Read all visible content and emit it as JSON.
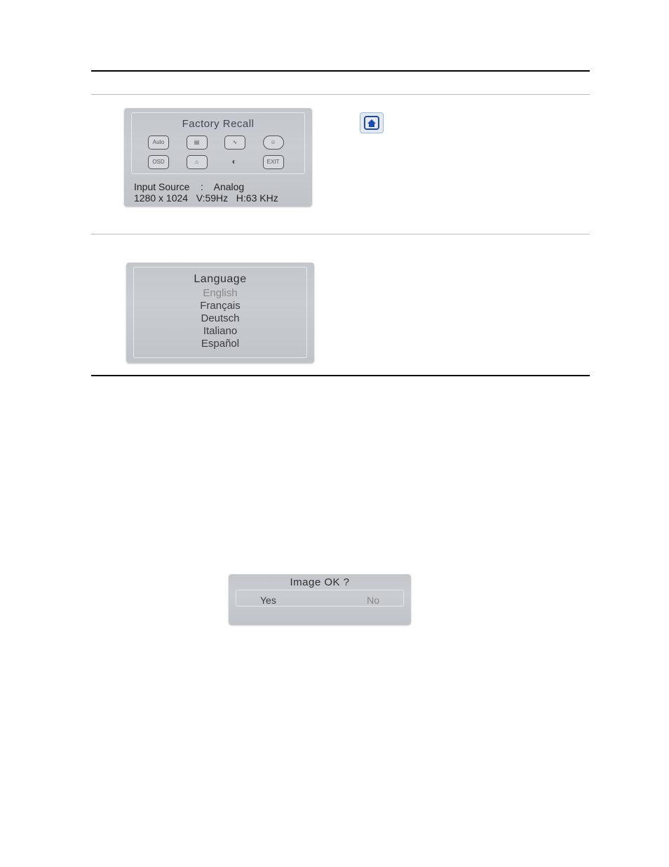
{
  "panels": {
    "factory": {
      "title": "Factory  Recall",
      "icons": [
        {
          "name": "auto-icon",
          "label": "Auto"
        },
        {
          "name": "menu-icon",
          "label": "▤"
        },
        {
          "name": "wave-icon",
          "label": "∿"
        },
        {
          "name": "face-icon",
          "label": "☺"
        },
        {
          "name": "osd-box-icon",
          "label": "OSD"
        },
        {
          "name": "home-small-icon",
          "label": "⌂"
        },
        {
          "name": "contrast-icon",
          "label": "◐"
        },
        {
          "name": "exit-icon",
          "label": "EXIT"
        }
      ],
      "status_line1": "Input Source    :    Analog",
      "status_line2": "1280 x 1024   V:59Hz   H:63 KHz"
    },
    "home_chip": {
      "glyph": "⌂"
    },
    "language": {
      "title": "Language",
      "selected": "English",
      "options": [
        "English",
        "Français",
        "Deutsch",
        "Italiano",
        "Español"
      ]
    },
    "image_ok": {
      "title": "Image  OK ?",
      "yes": "Yes",
      "no": "No",
      "selected": "No"
    }
  }
}
